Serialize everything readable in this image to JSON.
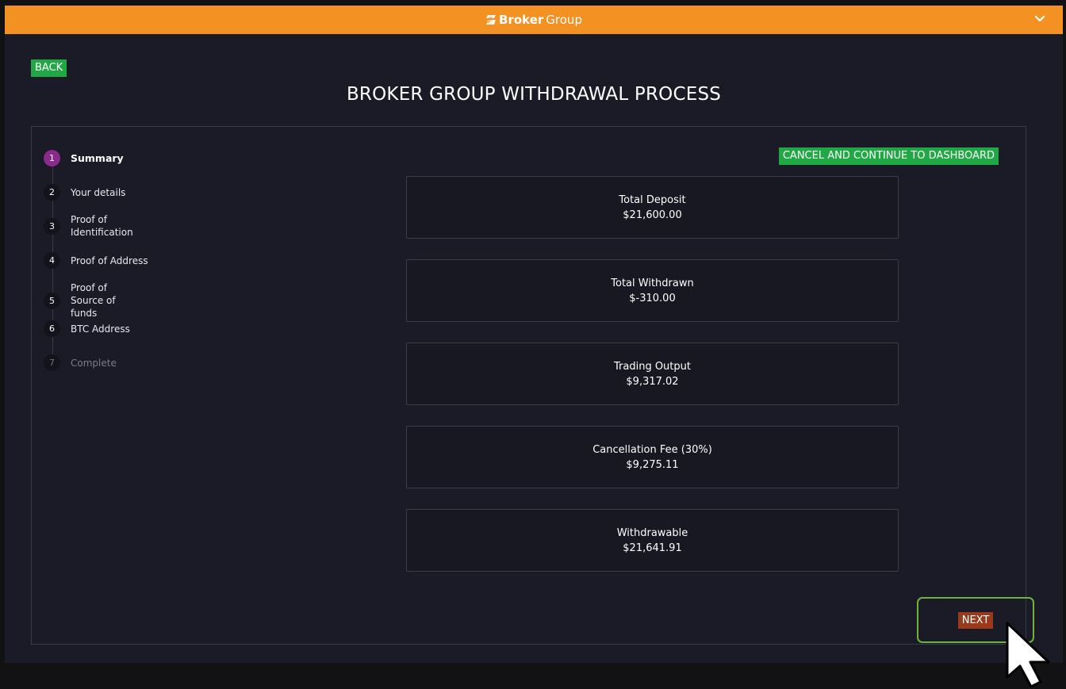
{
  "header": {
    "logo_bold": "Broker",
    "logo_light": "Group",
    "menu_icon": "chevron-down-icon",
    "background_color": "#f39122"
  },
  "nav": {
    "back_label": "BACK"
  },
  "page": {
    "title": "BROKER GROUP WITHDRAWAL PROCESS"
  },
  "steps": [
    {
      "num": "1",
      "label": "Summary",
      "state": "active"
    },
    {
      "num": "2",
      "label": "Your details",
      "state": "pending"
    },
    {
      "num": "3",
      "label": "Proof of Identification",
      "state": "pending"
    },
    {
      "num": "4",
      "label": "Proof of Address",
      "state": "pending"
    },
    {
      "num": "5",
      "label": "Proof of Source of funds",
      "state": "pending"
    },
    {
      "num": "6",
      "label": "BTC Address",
      "state": "pending"
    },
    {
      "num": "7",
      "label": "Complete",
      "state": "disabled"
    }
  ],
  "actions": {
    "cancel_label": "CANCEL AND CONTINUE TO DASHBOARD",
    "next_label": "NEXT"
  },
  "summary": [
    {
      "label": "Total Deposit",
      "value": "$21,600.00"
    },
    {
      "label": "Total Withdrawn",
      "value": "$-310.00"
    },
    {
      "label": "Trading Output",
      "value": "$9,317.02"
    },
    {
      "label": "Cancellation Fee (30%)",
      "value": "$9,275.11"
    },
    {
      "label": "Withdrawable",
      "value": "$21,641.91"
    }
  ],
  "colors": {
    "accent_orange": "#f39122",
    "green_button": "#1fa843",
    "active_step": "#8a2a8a",
    "next_button": "#9a3a1c",
    "highlight_border": "#6fb33e"
  }
}
